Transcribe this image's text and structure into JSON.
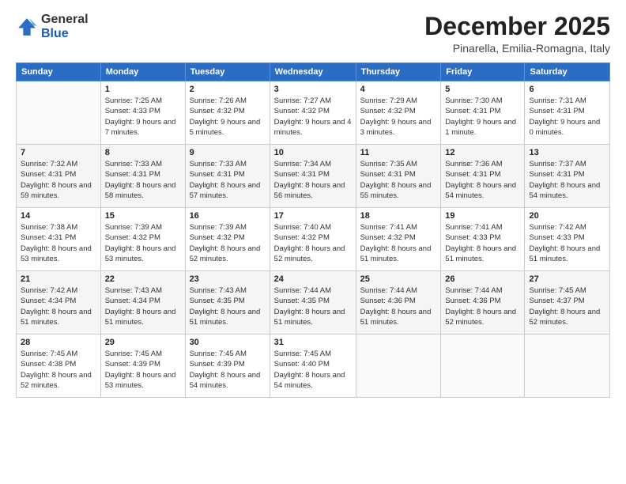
{
  "header": {
    "logo": {
      "general": "General",
      "blue": "Blue"
    },
    "title": "December 2025",
    "subtitle": "Pinarella, Emilia-Romagna, Italy"
  },
  "days_of_week": [
    "Sunday",
    "Monday",
    "Tuesday",
    "Wednesday",
    "Thursday",
    "Friday",
    "Saturday"
  ],
  "weeks": [
    {
      "alt": false,
      "days": [
        {
          "num": "",
          "sunrise": "",
          "sunset": "",
          "daylight": "",
          "empty": true
        },
        {
          "num": "1",
          "sunrise": "Sunrise: 7:25 AM",
          "sunset": "Sunset: 4:33 PM",
          "daylight": "Daylight: 9 hours and 7 minutes.",
          "empty": false
        },
        {
          "num": "2",
          "sunrise": "Sunrise: 7:26 AM",
          "sunset": "Sunset: 4:32 PM",
          "daylight": "Daylight: 9 hours and 5 minutes.",
          "empty": false
        },
        {
          "num": "3",
          "sunrise": "Sunrise: 7:27 AM",
          "sunset": "Sunset: 4:32 PM",
          "daylight": "Daylight: 9 hours and 4 minutes.",
          "empty": false
        },
        {
          "num": "4",
          "sunrise": "Sunrise: 7:29 AM",
          "sunset": "Sunset: 4:32 PM",
          "daylight": "Daylight: 9 hours and 3 minutes.",
          "empty": false
        },
        {
          "num": "5",
          "sunrise": "Sunrise: 7:30 AM",
          "sunset": "Sunset: 4:31 PM",
          "daylight": "Daylight: 9 hours and 1 minute.",
          "empty": false
        },
        {
          "num": "6",
          "sunrise": "Sunrise: 7:31 AM",
          "sunset": "Sunset: 4:31 PM",
          "daylight": "Daylight: 9 hours and 0 minutes.",
          "empty": false
        }
      ]
    },
    {
      "alt": true,
      "days": [
        {
          "num": "7",
          "sunrise": "Sunrise: 7:32 AM",
          "sunset": "Sunset: 4:31 PM",
          "daylight": "Daylight: 8 hours and 59 minutes.",
          "empty": false
        },
        {
          "num": "8",
          "sunrise": "Sunrise: 7:33 AM",
          "sunset": "Sunset: 4:31 PM",
          "daylight": "Daylight: 8 hours and 58 minutes.",
          "empty": false
        },
        {
          "num": "9",
          "sunrise": "Sunrise: 7:33 AM",
          "sunset": "Sunset: 4:31 PM",
          "daylight": "Daylight: 8 hours and 57 minutes.",
          "empty": false
        },
        {
          "num": "10",
          "sunrise": "Sunrise: 7:34 AM",
          "sunset": "Sunset: 4:31 PM",
          "daylight": "Daylight: 8 hours and 56 minutes.",
          "empty": false
        },
        {
          "num": "11",
          "sunrise": "Sunrise: 7:35 AM",
          "sunset": "Sunset: 4:31 PM",
          "daylight": "Daylight: 8 hours and 55 minutes.",
          "empty": false
        },
        {
          "num": "12",
          "sunrise": "Sunrise: 7:36 AM",
          "sunset": "Sunset: 4:31 PM",
          "daylight": "Daylight: 8 hours and 54 minutes.",
          "empty": false
        },
        {
          "num": "13",
          "sunrise": "Sunrise: 7:37 AM",
          "sunset": "Sunset: 4:31 PM",
          "daylight": "Daylight: 8 hours and 54 minutes.",
          "empty": false
        }
      ]
    },
    {
      "alt": false,
      "days": [
        {
          "num": "14",
          "sunrise": "Sunrise: 7:38 AM",
          "sunset": "Sunset: 4:31 PM",
          "daylight": "Daylight: 8 hours and 53 minutes.",
          "empty": false
        },
        {
          "num": "15",
          "sunrise": "Sunrise: 7:39 AM",
          "sunset": "Sunset: 4:32 PM",
          "daylight": "Daylight: 8 hours and 53 minutes.",
          "empty": false
        },
        {
          "num": "16",
          "sunrise": "Sunrise: 7:39 AM",
          "sunset": "Sunset: 4:32 PM",
          "daylight": "Daylight: 8 hours and 52 minutes.",
          "empty": false
        },
        {
          "num": "17",
          "sunrise": "Sunrise: 7:40 AM",
          "sunset": "Sunset: 4:32 PM",
          "daylight": "Daylight: 8 hours and 52 minutes.",
          "empty": false
        },
        {
          "num": "18",
          "sunrise": "Sunrise: 7:41 AM",
          "sunset": "Sunset: 4:32 PM",
          "daylight": "Daylight: 8 hours and 51 minutes.",
          "empty": false
        },
        {
          "num": "19",
          "sunrise": "Sunrise: 7:41 AM",
          "sunset": "Sunset: 4:33 PM",
          "daylight": "Daylight: 8 hours and 51 minutes.",
          "empty": false
        },
        {
          "num": "20",
          "sunrise": "Sunrise: 7:42 AM",
          "sunset": "Sunset: 4:33 PM",
          "daylight": "Daylight: 8 hours and 51 minutes.",
          "empty": false
        }
      ]
    },
    {
      "alt": true,
      "days": [
        {
          "num": "21",
          "sunrise": "Sunrise: 7:42 AM",
          "sunset": "Sunset: 4:34 PM",
          "daylight": "Daylight: 8 hours and 51 minutes.",
          "empty": false
        },
        {
          "num": "22",
          "sunrise": "Sunrise: 7:43 AM",
          "sunset": "Sunset: 4:34 PM",
          "daylight": "Daylight: 8 hours and 51 minutes.",
          "empty": false
        },
        {
          "num": "23",
          "sunrise": "Sunrise: 7:43 AM",
          "sunset": "Sunset: 4:35 PM",
          "daylight": "Daylight: 8 hours and 51 minutes.",
          "empty": false
        },
        {
          "num": "24",
          "sunrise": "Sunrise: 7:44 AM",
          "sunset": "Sunset: 4:35 PM",
          "daylight": "Daylight: 8 hours and 51 minutes.",
          "empty": false
        },
        {
          "num": "25",
          "sunrise": "Sunrise: 7:44 AM",
          "sunset": "Sunset: 4:36 PM",
          "daylight": "Daylight: 8 hours and 51 minutes.",
          "empty": false
        },
        {
          "num": "26",
          "sunrise": "Sunrise: 7:44 AM",
          "sunset": "Sunset: 4:36 PM",
          "daylight": "Daylight: 8 hours and 52 minutes.",
          "empty": false
        },
        {
          "num": "27",
          "sunrise": "Sunrise: 7:45 AM",
          "sunset": "Sunset: 4:37 PM",
          "daylight": "Daylight: 8 hours and 52 minutes.",
          "empty": false
        }
      ]
    },
    {
      "alt": false,
      "days": [
        {
          "num": "28",
          "sunrise": "Sunrise: 7:45 AM",
          "sunset": "Sunset: 4:38 PM",
          "daylight": "Daylight: 8 hours and 52 minutes.",
          "empty": false
        },
        {
          "num": "29",
          "sunrise": "Sunrise: 7:45 AM",
          "sunset": "Sunset: 4:39 PM",
          "daylight": "Daylight: 8 hours and 53 minutes.",
          "empty": false
        },
        {
          "num": "30",
          "sunrise": "Sunrise: 7:45 AM",
          "sunset": "Sunset: 4:39 PM",
          "daylight": "Daylight: 8 hours and 54 minutes.",
          "empty": false
        },
        {
          "num": "31",
          "sunrise": "Sunrise: 7:45 AM",
          "sunset": "Sunset: 4:40 PM",
          "daylight": "Daylight: 8 hours and 54 minutes.",
          "empty": false
        },
        {
          "num": "",
          "sunrise": "",
          "sunset": "",
          "daylight": "",
          "empty": true
        },
        {
          "num": "",
          "sunrise": "",
          "sunset": "",
          "daylight": "",
          "empty": true
        },
        {
          "num": "",
          "sunrise": "",
          "sunset": "",
          "daylight": "",
          "empty": true
        }
      ]
    }
  ]
}
